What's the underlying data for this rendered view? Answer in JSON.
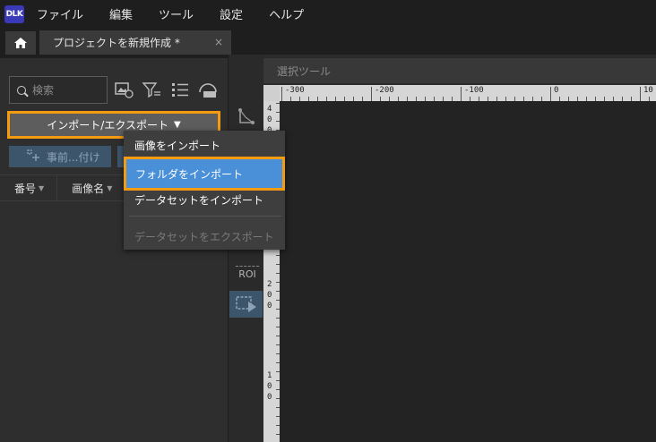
{
  "app": {
    "logo_text": "DLK"
  },
  "menu": [
    "ファイル",
    "編集",
    "ツール",
    "設定",
    "ヘルプ"
  ],
  "tab": {
    "title": "プロジェクトを新規作成 *",
    "close": "×"
  },
  "left_panel": {
    "search_placeholder": "検索",
    "import_export_label": "インポート/エクスポート",
    "prefill_label": "事前...付け",
    "columns": [
      "番号",
      "画像名"
    ]
  },
  "dropdown": {
    "items": [
      {
        "label": "画像をインポート",
        "state": "normal"
      },
      {
        "label": "フォルダをインポート",
        "state": "highlighted"
      },
      {
        "label": "データセットをインポート",
        "state": "normal"
      },
      {
        "label": "データセットをエクスポート",
        "state": "disabled"
      }
    ]
  },
  "mid_toolbar": {
    "roi_label": "ROI"
  },
  "canvas": {
    "tool_bar_label": "選択ツール",
    "h_ruler_labels": [
      "-300",
      "-200",
      "-100",
      "0",
      "10"
    ],
    "v_ruler_digits_top": [
      "4",
      "0",
      "0"
    ],
    "v_ruler_digits_mid": [
      "2",
      "0",
      "0"
    ],
    "v_ruler_digits_bottom": [
      "1",
      "0",
      "0"
    ]
  },
  "colors": {
    "highlight": "#4a90d9",
    "accent_outline": "#f39c12"
  }
}
